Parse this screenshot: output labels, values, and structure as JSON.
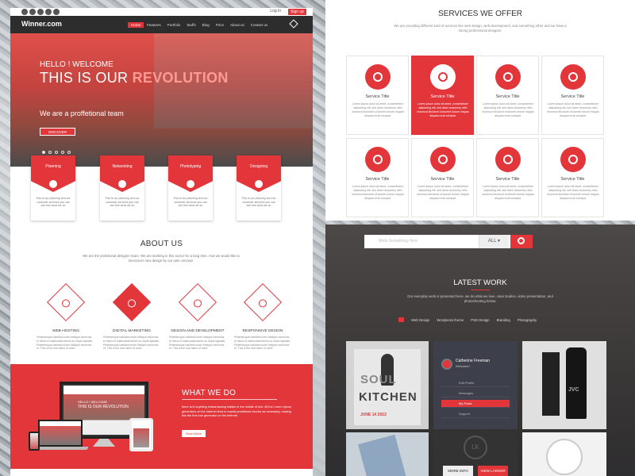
{
  "topbar": {
    "login": "Log in",
    "signup": "Sign up"
  },
  "header": {
    "logo": "Winner.com",
    "nav": [
      "Home",
      "Features",
      "Portfolio",
      "Stuffs",
      "Blog",
      "Price",
      "About us",
      "Contact us"
    ]
  },
  "hero": {
    "greeting": "HELLO ! WELCOME",
    "headline_a": "THIS IS OUR ",
    "headline_b": "REVOLUTION",
    "tagline": "We are a proffetional team",
    "cta": "DISCOVER"
  },
  "features": [
    {
      "title": "Planning",
      "desc": "This is our planning and our customer services you can see this what we do",
      "icon": "target-icon"
    },
    {
      "title": "Networking",
      "desc": "This is our planning and our customer services you can see this what we do",
      "icon": "rss-icon"
    },
    {
      "title": "Phototyping",
      "desc": "This is our planning and our customer services you can see this what we do",
      "icon": "document-icon"
    },
    {
      "title": "Designing",
      "desc": "This is our planning and our customer services you can see this what we do",
      "icon": "clipboard-icon"
    }
  ],
  "about": {
    "title": "ABOUT US",
    "desc": "We are the profetional designer team. We are working in this sector for a long time. And we would like to Desicover new design by our own concept.",
    "services": [
      {
        "title": "WEB HOSTING",
        "desc": "Pellentesque habitant morbi tristique senectus et netus et malesuada fames ac turpis egestas. Pellentesque habitant morbi tristique senectus et. This is the real name of more"
      },
      {
        "title": "DIGITAL MARKETING",
        "desc": "Pellentesque habitant morbi tristique senectus et netus et malesuada fames ac turpis egestas. Pellentesque habitant morbi tristique senectus et. This is the real name of more"
      },
      {
        "title": "DESIGN AND DEVELOPMENT",
        "desc": "Pellentesque habitant morbi tristique senectus et netus et malesuada fames ac turpis egestas. Pellentesque habitant morbi tristique senectus et. This is the real name of more"
      },
      {
        "title": "RESPONSIVE DESIGN",
        "desc": "Pellentesque habitant morbi tristique senectus et netus et malesuada fames ac turpis egestas. Pellentesque habitant morbi tristique senectus et. This is the real name of more"
      }
    ]
  },
  "whatwedo": {
    "title": "WHAT WE DO",
    "text": "there isn't anything embarrassing hidden in the middle of text. All the Lorem Ipsum generators on the Internet tend to repeat predefined chunks as necessary, making this the first true generator on the Internet.",
    "button": "Read More",
    "device_headline": "HELLO ! WELCOME",
    "device_sub": "THIS IS OUR REVOLUTION"
  },
  "services": {
    "title": "SERVICES WE OFFER",
    "desc": "We are providing different kind of services like web design, web development, and something other and we have a strong professional designer.",
    "cards": [
      {
        "title": "Service Title",
        "desc": "Lorem ipsum dolor sit amet, consectetuer adipiscing elit, sed diam nonummy nibh euismod tincidunt ut laoreet dolore magna aliquam erat volutpat.",
        "icon": "people-icon"
      },
      {
        "title": "Service Title",
        "desc": "Lorem ipsum dolor sit amet, consectetuer adipiscing elit, sed diam nonummy nibh euismod tincidunt ut laoreet dolore magna aliquam erat volutpat.",
        "icon": "stopwatch-icon"
      },
      {
        "title": "Service Title",
        "desc": "Lorem ipsum dolor sit amet, consectetuer adipiscing elit, sed diam nonummy nibh euismod tincidunt ut laoreet dolore magna aliquam erat volutpat.",
        "icon": "graduation-cap-icon"
      },
      {
        "title": "Service Title",
        "desc": "Lorem ipsum dolor sit amet, consectetuer adipiscing elit, sed diam nonummy nibh euismod tincidunt ut laoreet dolore magna aliquam erat volutpat.",
        "icon": "bar-chart-icon"
      },
      {
        "title": "Service Title",
        "desc": "Lorem ipsum dolor sit amet, consectetuer adipiscing elit, sed diam nonummy nibh euismod tincidunt ut laoreet dolore magna aliquam erat volutpat.",
        "icon": "line-chart-icon"
      },
      {
        "title": "Service Title",
        "desc": "Lorem ipsum dolor sit amet, consectetuer adipiscing elit, sed diam nonummy nibh euismod tincidunt ut laoreet dolore magna aliquam erat volutpat.",
        "icon": "target-icon"
      },
      {
        "title": "Service Title",
        "desc": "Lorem ipsum dolor sit amet, consectetuer adipiscing elit, sed diam nonummy nibh euismod tincidunt ut laoreet dolore magna aliquam erat volutpat.",
        "icon": "diamond-icon"
      },
      {
        "title": "Service Title",
        "desc": "Lorem ipsum dolor sit amet, consectetuer adipiscing elit, sed diam nonummy nibh euismod tincidunt ut laoreet dolore magna aliquam erat volutpat.",
        "icon": "shield-icon"
      }
    ]
  },
  "search": {
    "placeholder": "Write Something Here",
    "filter": "ALL"
  },
  "latest": {
    "title": "LATEST WORK",
    "desc": "Our everyday work is presented here, we do what we love, case studies, video presentation, and photoshooting below.",
    "filters": [
      "Web Design",
      "Wordpress theme",
      "PSD Design",
      "Branding",
      "Photography"
    ],
    "kitchen": {
      "line1": "SOUL",
      "line2": "KITCHEN",
      "date": "JUNE 14 2013"
    },
    "profile": {
      "name": "Catherine Freeman",
      "welcome": "Welcome!",
      "menu": [
        "Edit Profile",
        "Messages",
        "My Posts",
        "Support"
      ]
    },
    "bottle": "JVC",
    "seal": "LK",
    "overlay": {
      "more": "MORE INFO",
      "view": "VIEW LARGER"
    }
  },
  "colors": {
    "accent": "#e2363b",
    "dark": "#2d2d2d"
  }
}
